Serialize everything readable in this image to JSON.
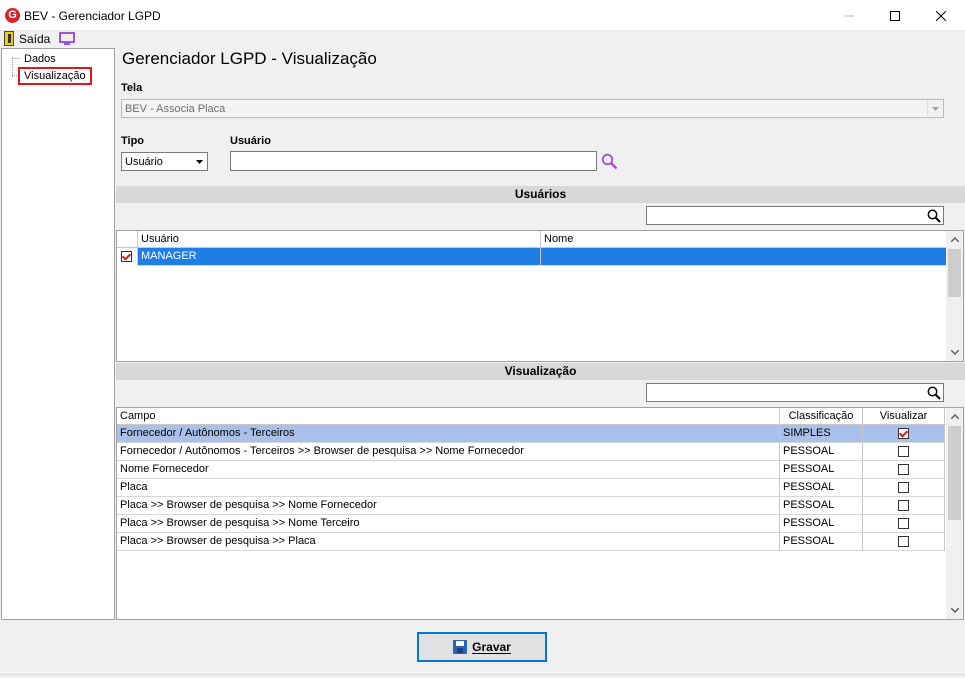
{
  "window": {
    "logo_letter": "G",
    "title": "BEV - Gerenciador LGPD"
  },
  "toolbar": {
    "exit_label": "Saída"
  },
  "tree": {
    "items": [
      {
        "label": "Dados"
      },
      {
        "label": "Visualização",
        "selected": true
      }
    ]
  },
  "page": {
    "heading": "Gerenciador LGPD - Visualização"
  },
  "form": {
    "tela_label": "Tela",
    "tela_value": "BEV - Associa Placa",
    "tipo_label": "Tipo",
    "tipo_value": "Usuário",
    "usuario_label": "Usuário",
    "usuario_value": ""
  },
  "usuarios_section": {
    "title": "Usuários",
    "filter_value": "",
    "columns": [
      "",
      "Usuário",
      "Nome"
    ],
    "rows": [
      {
        "checked": true,
        "usuario": "MANAGER",
        "nome": ""
      }
    ]
  },
  "visualizacao_section": {
    "title": "Visualização",
    "filter_value": "",
    "columns": [
      "Campo",
      "Classificação",
      "Visualizar"
    ],
    "rows": [
      {
        "campo": "Fornecedor / Autônomos - Terceiros",
        "classificacao": "SIMPLES",
        "visualizar": true
      },
      {
        "campo": "Fornecedor / Autônomos - Terceiros >> Browser de pesquisa >> Nome Fornecedor",
        "classificacao": "PESSOAL",
        "visualizar": false
      },
      {
        "campo": "Nome Fornecedor",
        "classificacao": "PESSOAL",
        "visualizar": false
      },
      {
        "campo": "Placa",
        "classificacao": "PESSOAL",
        "visualizar": false
      },
      {
        "campo": "Placa >> Browser de pesquisa >> Nome Fornecedor",
        "classificacao": "PESSOAL",
        "visualizar": false
      },
      {
        "campo": "Placa >> Browser de pesquisa >> Nome Terceiro",
        "classificacao": "PESSOAL",
        "visualizar": false
      },
      {
        "campo": "Placa >> Browser de pesquisa >> Placa",
        "classificacao": "PESSOAL",
        "visualizar": false
      }
    ]
  },
  "actions": {
    "save_label": "Gravar"
  },
  "colors": {
    "selection_blue": "#1f7ee6",
    "selection_light": "#a9c0ea",
    "accent_red": "#e0161e",
    "search_purple": "#a64bd6"
  }
}
